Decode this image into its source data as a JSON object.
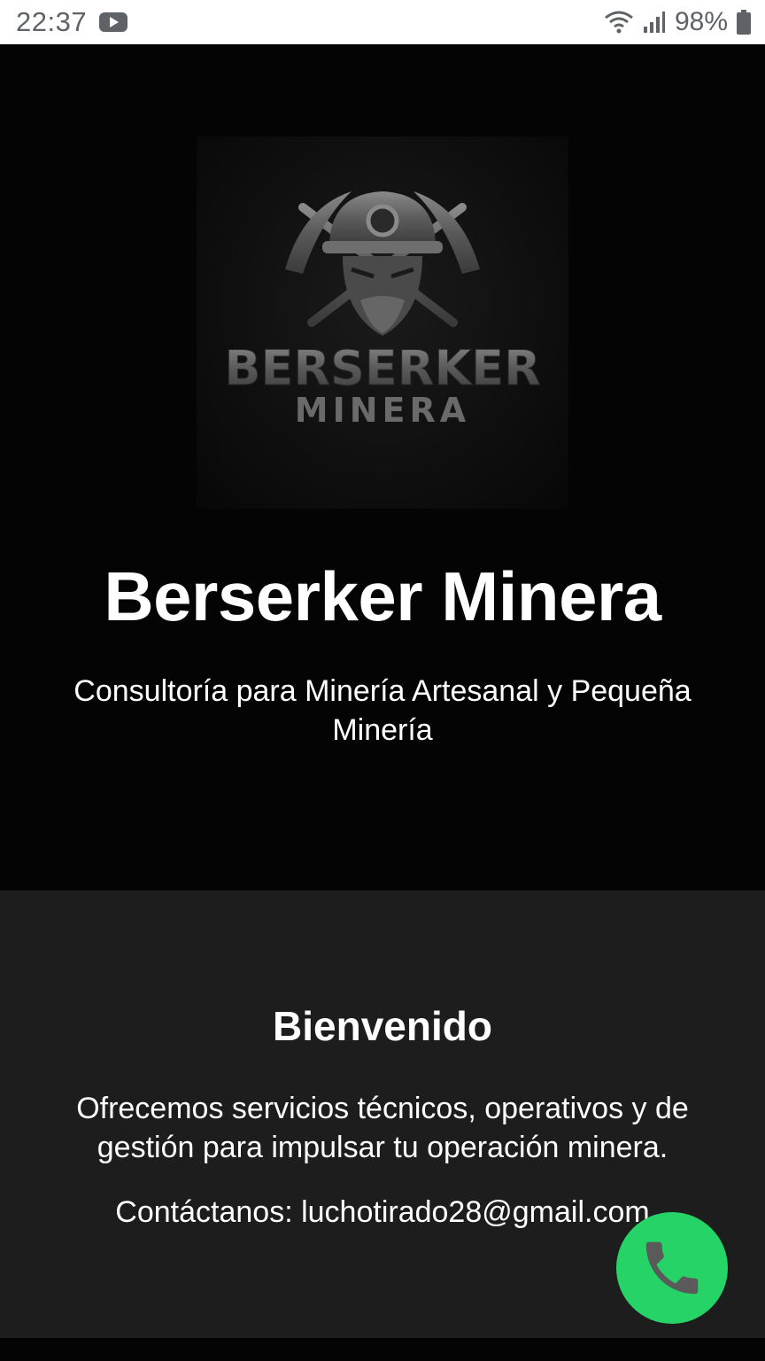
{
  "status_bar": {
    "time": "22:37",
    "battery": "98%",
    "icons": [
      "youtube-icon",
      "wifi-icon",
      "signal-icon",
      "battery-icon"
    ]
  },
  "hero": {
    "logo": {
      "line1": "BERSERKER",
      "line2": "MINERA"
    },
    "title": "Berserker Minera",
    "subtitle": "Consultoría para Minería Artesanal y Pequeña Minería"
  },
  "welcome": {
    "title": "Bienvenido",
    "text": "Ofrecemos servicios técnicos, operativos y de gestión para impulsar tu operación minera.",
    "contact": "Contáctanos: luchotirado28@gmail.com"
  },
  "fab": {
    "icon": "phone-icon",
    "color": "#25d366"
  }
}
